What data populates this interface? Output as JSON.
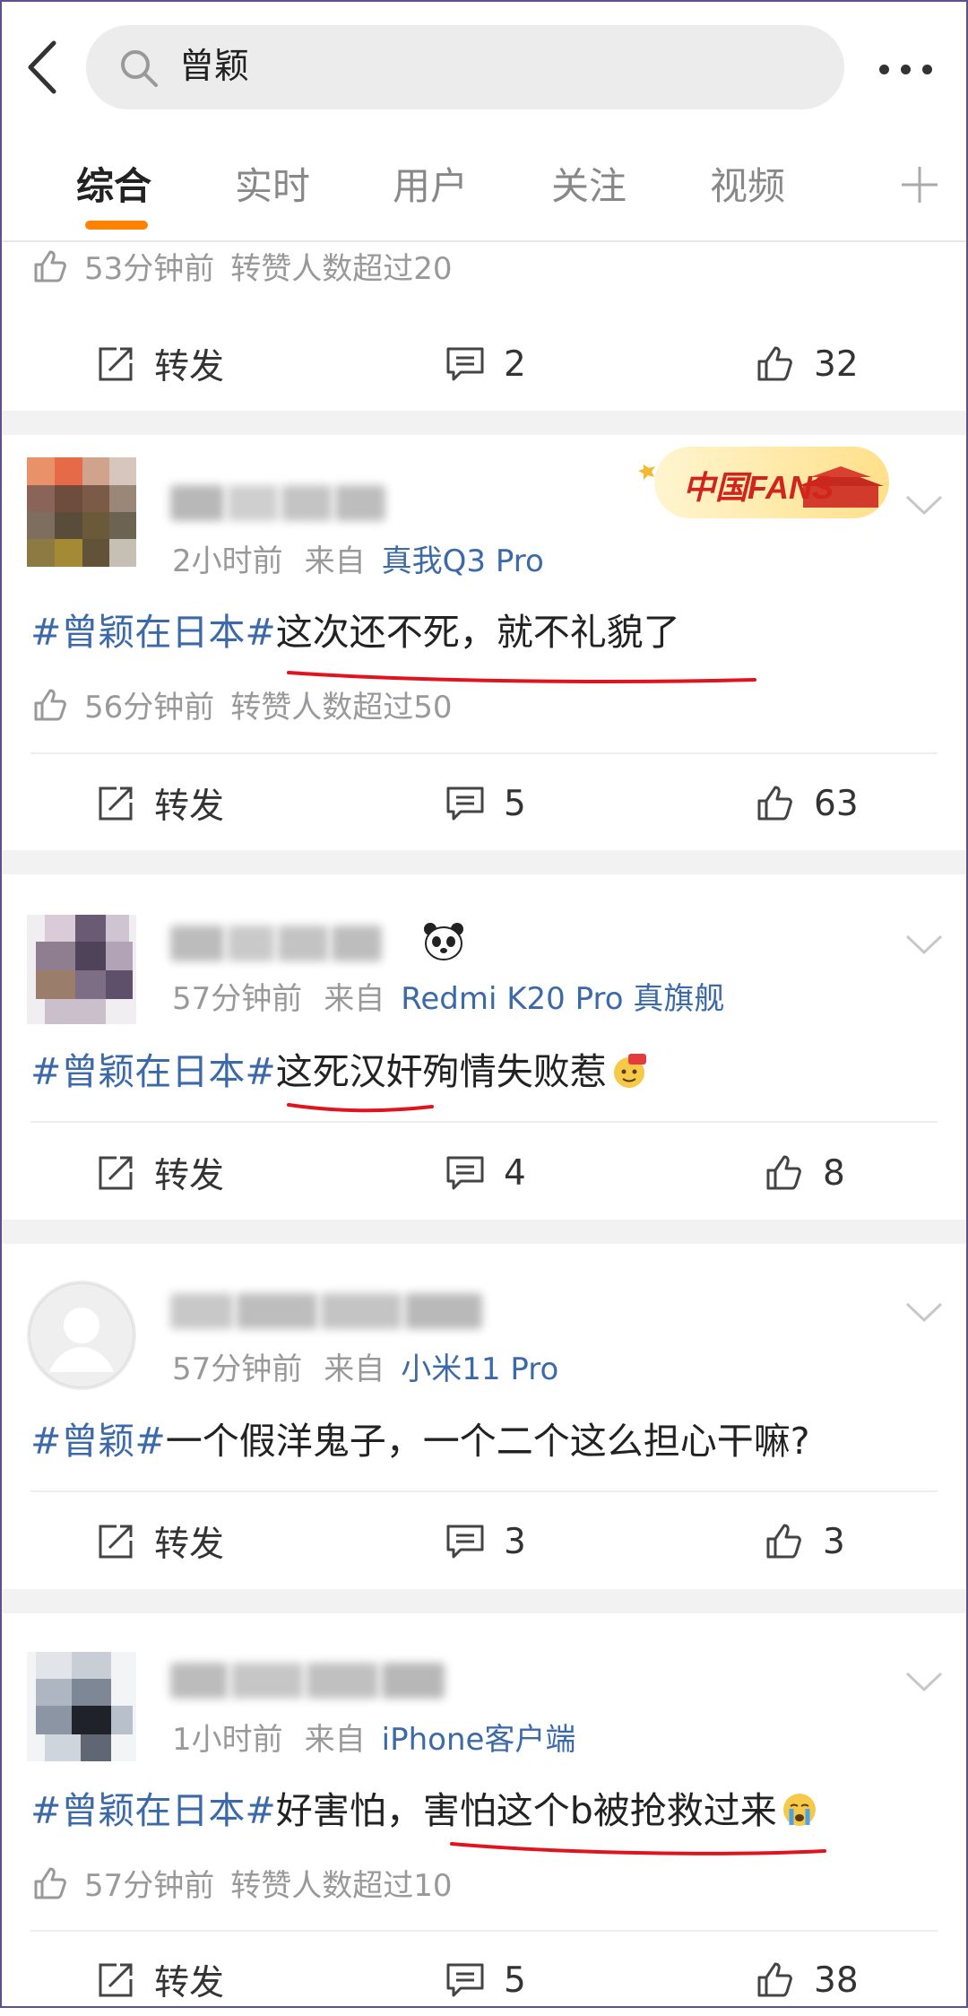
{
  "header": {
    "search_value": "曾颖"
  },
  "tabs": [
    "综合",
    "实时",
    "用户",
    "关注",
    "视频"
  ],
  "prev_post": {
    "likes_line": {
      "time": "53分钟前",
      "text": "转赞人数超过20"
    },
    "actions": {
      "repost": "转发",
      "comments": "2",
      "likes": "32"
    }
  },
  "posts": [
    {
      "time": "2小时前",
      "from_label": "来自",
      "source": "真我Q3 Pro",
      "badge": "中国FANS",
      "hashtag": "#曾颖在日本#",
      "text": "这次还不死，就不礼貌了",
      "likes_line": {
        "time": "56分钟前",
        "text": "转赞人数超过50"
      },
      "actions": {
        "repost": "转发",
        "comments": "5",
        "likes": "63"
      }
    },
    {
      "time": "57分钟前",
      "from_label": "来自",
      "source": "Redmi K20 Pro 真旗舰",
      "hashtag": "#曾颖在日本#",
      "text": "这死汉奸殉情失败惹",
      "actions": {
        "repost": "转发",
        "comments": "4",
        "likes": "8"
      }
    },
    {
      "time": "57分钟前",
      "from_label": "来自",
      "source": "小米11 Pro",
      "hashtag": "#曾颖#",
      "text": "一个假洋鬼子，一个二个这么担心干嘛?",
      "actions": {
        "repost": "转发",
        "comments": "3",
        "likes": "3"
      }
    },
    {
      "time": "1小时前",
      "from_label": "来自",
      "source": "iPhone客户端",
      "hashtag": "#曾颖在日本#",
      "text": "好害怕，害怕这个b被抢救过来",
      "likes_line": {
        "time": "57分钟前",
        "text": "转赞人数超过10"
      },
      "actions": {
        "repost": "转发",
        "comments": "5",
        "likes": "38"
      }
    }
  ],
  "colors": {
    "accent": "#ff8200",
    "link": "#3c6aa8",
    "underline_mark": "#e0141e",
    "separator": "#f2f2f2"
  }
}
